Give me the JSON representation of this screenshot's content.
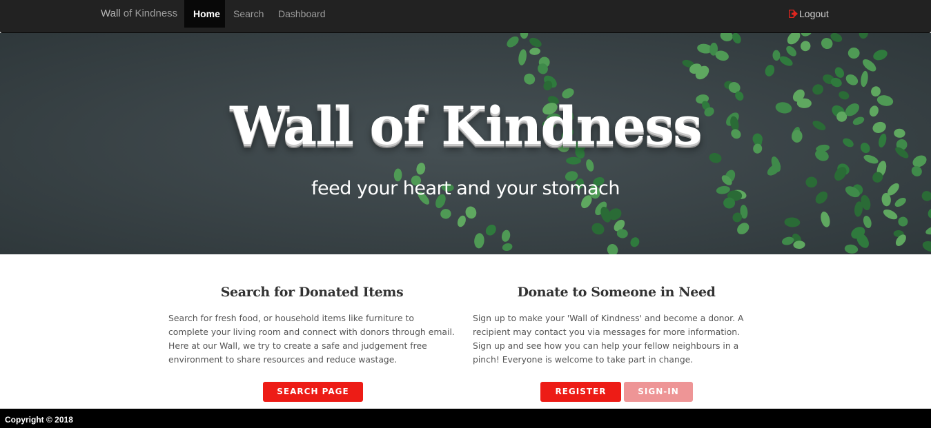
{
  "nav": {
    "brand_main": "Wall",
    "brand_rest": " of Kindness",
    "items": [
      {
        "label": "Home",
        "active": true
      },
      {
        "label": "Search",
        "active": false
      },
      {
        "label": "Dashboard",
        "active": false
      }
    ],
    "logout_label": "Logout",
    "logout_icon": "sign-out-icon"
  },
  "hero": {
    "title": "Wall of Kindness",
    "subtitle": "feed your heart and your stomach"
  },
  "search_section": {
    "heading": "Search for Donated Items",
    "text": "Search for fresh food, or household items like furniture to complete your living room and connect with donors through email. Here at our Wall, we try to create a safe and judgement free environment to share resources and reduce wastage.",
    "button_label": "SEARCH PAGE"
  },
  "donate_section": {
    "heading": "Donate to Someone in Need",
    "text": "Sign up to make your 'Wall of Kindness' and become a donor. A recipient may contact you via messages for more information. Sign up and see how you can help your fellow neighbours in a pinch! Everyone is welcome to take part in change.",
    "register_label": "REGISTER",
    "signin_label": "SIGN-IN"
  },
  "footer": {
    "copyright": "Copyright © 2018"
  },
  "colors": {
    "navbar": "#222222",
    "accent": "#ed1c16",
    "accent_light": "#ee9596",
    "hero_bg": "#3c4548",
    "leaf": "#3f8a4a"
  }
}
